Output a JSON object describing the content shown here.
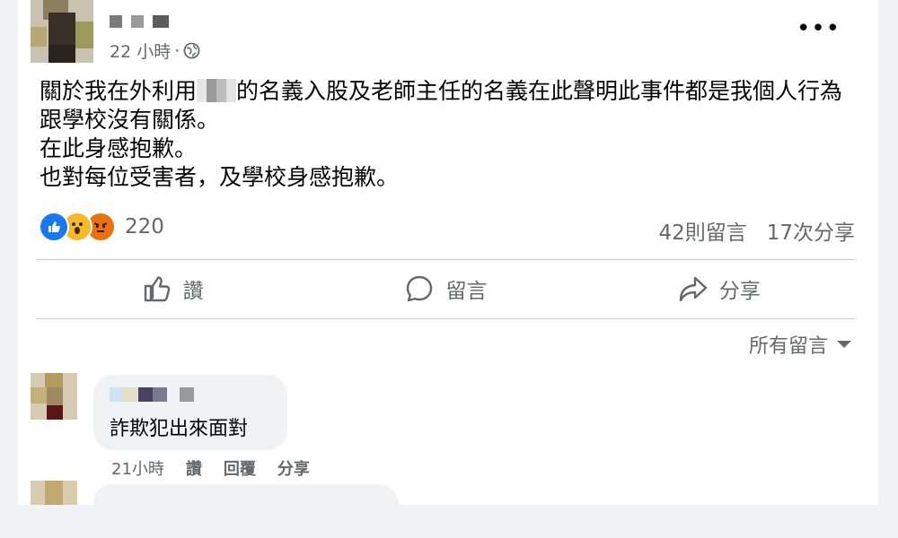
{
  "post": {
    "time": "22 小時",
    "dot": "·",
    "more": "•••",
    "lines": {
      "l1a": "關於我在外利用",
      "l1b": "的名義入股及老師主任的名義在此聲明此事件都是我個人行為",
      "l2": "跟學校沒有關係。",
      "l3": "在此身感抱歉。",
      "l4": "也對每位受害者，及學校身感抱歉。"
    },
    "reactions": [
      "like-icon",
      "wow-icon",
      "angry-icon"
    ],
    "reaction_count": "220",
    "comments_count": "42則留言",
    "shares_count": "17次分享"
  },
  "actions": {
    "like": "讚",
    "comment": "留言",
    "share": "分享"
  },
  "sort_label": "所有留言",
  "comments": [
    {
      "text": "詐欺犯出來面對",
      "time": "21小時",
      "like": "讚",
      "reply": "回覆",
      "share": "分享"
    }
  ],
  "colors": {
    "brand_blue": "#1877f2",
    "secondary_text": "#65676b",
    "bubble_bg": "#f0f2f5"
  }
}
